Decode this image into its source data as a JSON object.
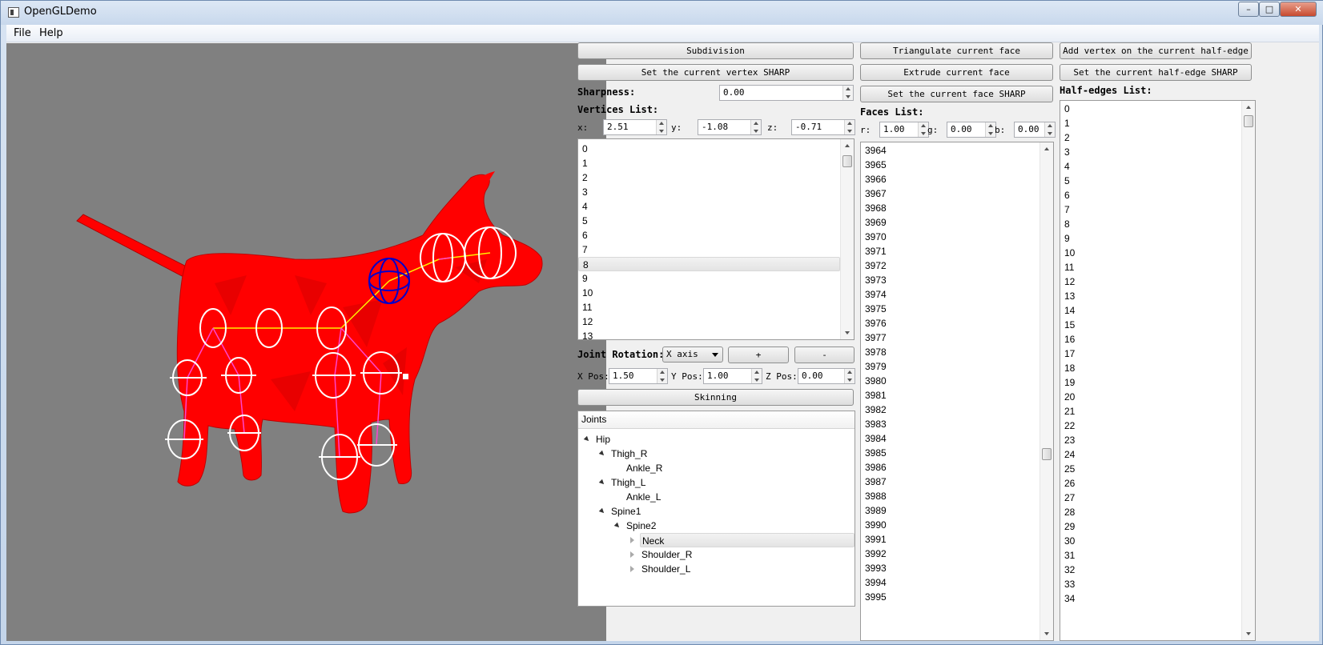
{
  "window": {
    "title": "OpenGLDemo",
    "min_glyph": "–",
    "max_glyph": "□",
    "close_glyph": "✕"
  },
  "menu": {
    "file": "File",
    "help": "Help"
  },
  "buttons": {
    "subdivision": "Subdivision",
    "set_vertex_sharp": "Set the current vertex SHARP",
    "triangulate_face": "Triangulate current face",
    "extrude_face": "Extrude current face",
    "set_face_sharp": "Set the current face SHARP",
    "add_vertex_half_edge": "Add vertex on the current half-edge",
    "set_half_edge_sharp": "Set the current half-edge SHARP",
    "joint_plus": "+",
    "joint_minus": "-",
    "skinning": "Skinning"
  },
  "sharpness": {
    "label": "Sharpness:",
    "value": "0.00"
  },
  "vertices": {
    "label": "Vertices List:",
    "x_label": "x:",
    "x": "2.51",
    "y_label": "y:",
    "y": "-1.08",
    "z_label": "z:",
    "z": "-0.71",
    "items": [
      "0",
      "1",
      "2",
      "3",
      "4",
      "5",
      "6",
      "7",
      "8",
      "9",
      "10",
      "11",
      "12",
      "13"
    ],
    "selected": "8"
  },
  "faces": {
    "label": "Faces List:",
    "r_label": "r:",
    "r": "1.00",
    "g_label": "g:",
    "g": "0.00",
    "b_label": "b:",
    "b": "0.00",
    "items": [
      "3964",
      "3965",
      "3966",
      "3967",
      "3968",
      "3969",
      "3970",
      "3971",
      "3972",
      "3973",
      "3974",
      "3975",
      "3976",
      "3977",
      "3978",
      "3979",
      "3980",
      "3981",
      "3982",
      "3983",
      "3984",
      "3985",
      "3986",
      "3987",
      "3988",
      "3989",
      "3990",
      "3991",
      "3992",
      "3993",
      "3994",
      "3995"
    ]
  },
  "half_edges": {
    "label": "Half-edges List:",
    "items": [
      "0",
      "1",
      "2",
      "3",
      "4",
      "5",
      "6",
      "7",
      "8",
      "9",
      "10",
      "11",
      "12",
      "13",
      "14",
      "15",
      "16",
      "17",
      "18",
      "19",
      "20",
      "21",
      "22",
      "23",
      "24",
      "25",
      "26",
      "27",
      "28",
      "29",
      "30",
      "31",
      "32",
      "33",
      "34"
    ]
  },
  "joint_rotation": {
    "label": "Joint Rotation:",
    "axis": "X axis"
  },
  "joint_pos": {
    "x_label": "X Pos:",
    "x": "1.50",
    "y_label": "Y Pos:",
    "y": "1.00",
    "z_label": "Z Pos:",
    "z": "0.00"
  },
  "joints": {
    "header": "Joints",
    "nodes": [
      "Hip",
      "Thigh_R",
      "Ankle_R",
      "Thigh_L",
      "Ankle_L",
      "Spine1",
      "Spine2",
      "Neck",
      "Shoulder_R",
      "Shoulder_L"
    ],
    "selected": "Neck"
  },
  "colors": {
    "viewport_bg": "#808080",
    "mesh": "#ff0000",
    "joint_ring": "#ffffff",
    "selected_joint": "#0000cc",
    "bone": "#ff44cc",
    "bone_link": "#ffee00"
  }
}
